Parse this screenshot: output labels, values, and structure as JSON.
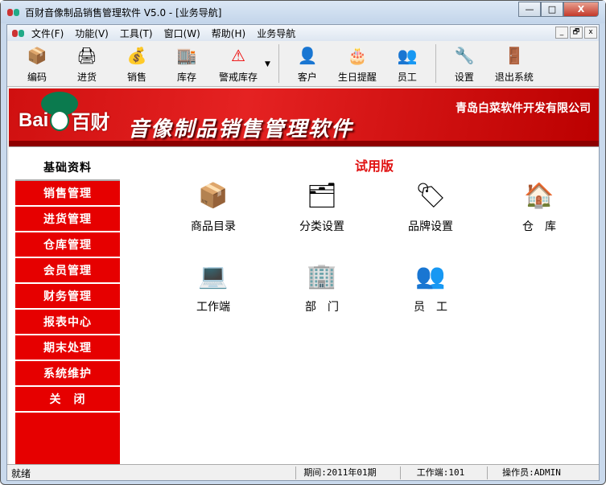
{
  "window": {
    "title": "百财音像制品销售管理软件 V5.0 - [业务导航]",
    "minimize": "—",
    "maximize": "□",
    "close": "X"
  },
  "menu": [
    "文件(F)",
    "功能(V)",
    "工具(T)",
    "窗口(W)",
    "帮助(H)",
    "业务导航"
  ],
  "mdi": [
    "_",
    "🗗",
    "x"
  ],
  "toolbar": [
    {
      "label": "编码",
      "icon": "boxes-icon",
      "glyph": "📦"
    },
    {
      "label": "进货",
      "icon": "printer-icon",
      "glyph": "🖨"
    },
    {
      "label": "销售",
      "icon": "money-bag-icon",
      "glyph": "💰"
    },
    {
      "label": "库存",
      "icon": "warehouse-icon",
      "glyph": "🏬"
    },
    {
      "label": "警戒库存",
      "icon": "warning-icon",
      "glyph": "⚠"
    },
    {
      "label": "客户",
      "icon": "customer-icon",
      "glyph": "👤"
    },
    {
      "label": "生日提醒",
      "icon": "birthday-icon",
      "glyph": "🎂"
    },
    {
      "label": "员工",
      "icon": "staff-icon",
      "glyph": "👥"
    },
    {
      "label": "设置",
      "icon": "settings-icon",
      "glyph": "🔧"
    },
    {
      "label": "退出系统",
      "icon": "exit-icon",
      "glyph": "🚪"
    }
  ],
  "dropdown_arrow": "▼",
  "banner": {
    "logo_text": "Bai",
    "logo_cn": "百财",
    "title": "音像制品销售管理软件",
    "company": "青岛白菜软件开发有限公司"
  },
  "sidebar": [
    "基础资料",
    "销售管理",
    "进货管理",
    "仓库管理",
    "会员管理",
    "财务管理",
    "报表中心",
    "期末处理",
    "系统维护",
    "关　闭"
  ],
  "trial": "试用版",
  "items": [
    {
      "label": "商品目录",
      "icon": "boxes-icon",
      "glyph": "📦"
    },
    {
      "label": "分类设置",
      "icon": "category-icon",
      "glyph": "🗂"
    },
    {
      "label": "品牌设置",
      "icon": "brand-icon",
      "glyph": "🏷"
    },
    {
      "label": "仓　库",
      "icon": "warehouse-icon",
      "glyph": "🏠"
    },
    {
      "label": "工作端",
      "icon": "computer-icon",
      "glyph": "💻"
    },
    {
      "label": "部　门",
      "icon": "department-icon",
      "glyph": "🏢"
    },
    {
      "label": "员　工",
      "icon": "staff-icon",
      "glyph": "👥"
    }
  ],
  "status": {
    "ready": "就绪",
    "period": "期间:2011年01期",
    "terminal": "工作端:101",
    "operator": "操作员:ADMIN"
  }
}
